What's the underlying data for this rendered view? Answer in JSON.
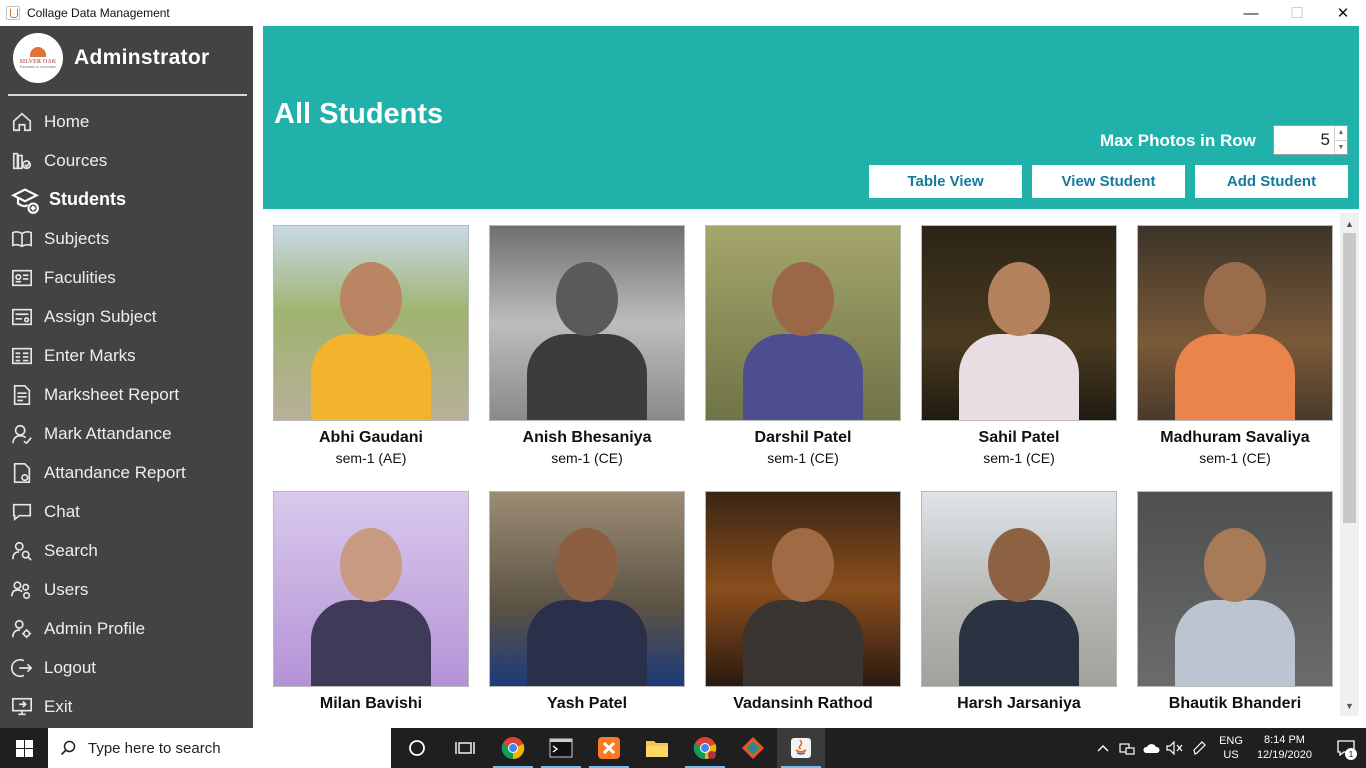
{
  "window": {
    "title": "Collage Data Management",
    "controls": {
      "minimize": "—",
      "maximize": "☐",
      "close": "✕"
    }
  },
  "sidebar": {
    "logo_text": "SILVER OAK",
    "logo_subtext": "Education to Innovation",
    "admin_label": "Adminstrator",
    "items": [
      {
        "label": "Home",
        "icon": "home-icon"
      },
      {
        "label": "Cources",
        "icon": "books-icon"
      },
      {
        "label": "Students",
        "icon": "graduation-cap-icon",
        "active": true
      },
      {
        "label": "Subjects",
        "icon": "open-book-icon"
      },
      {
        "label": "Faculities",
        "icon": "id-card-icon"
      },
      {
        "label": "Assign Subject",
        "icon": "assign-icon"
      },
      {
        "label": "Enter Marks",
        "icon": "marks-icon"
      },
      {
        "label": "Marksheet Report",
        "icon": "report-icon"
      },
      {
        "label": "Mark Attandance",
        "icon": "attendance-icon"
      },
      {
        "label": "Attandance Report",
        "icon": "document-icon"
      },
      {
        "label": "Chat",
        "icon": "chat-icon"
      },
      {
        "label": "Search",
        "icon": "search-user-icon"
      },
      {
        "label": "Users",
        "icon": "users-icon"
      },
      {
        "label": "Admin Profile",
        "icon": "admin-profile-icon"
      },
      {
        "label": "Logout",
        "icon": "logout-icon"
      },
      {
        "label": "Exit",
        "icon": "exit-icon"
      }
    ]
  },
  "header": {
    "title": "All Students",
    "max_photos_label": "Max Photos in Row",
    "max_photos_value": "5",
    "buttons": {
      "table_view": "Table View",
      "view_student": "View Student",
      "add_student": "Add Student"
    },
    "color": "#21b1ab"
  },
  "students": [
    {
      "name": "Abhi Gaudani",
      "sem": "sem-1  (AE)"
    },
    {
      "name": "Anish Bhesaniya",
      "sem": "sem-1  (CE)"
    },
    {
      "name": "Darshil Patel",
      "sem": "sem-1  (CE)"
    },
    {
      "name": "Sahil Patel",
      "sem": "sem-1  (CE)"
    },
    {
      "name": "Madhuram Savaliya",
      "sem": "sem-1  (CE)"
    },
    {
      "name": "Milan Bavishi",
      "sem": ""
    },
    {
      "name": "Yash Patel",
      "sem": ""
    },
    {
      "name": "Vadansinh Rathod",
      "sem": ""
    },
    {
      "name": "Harsh Jarsaniya",
      "sem": ""
    },
    {
      "name": "Bhautik Bhanderi",
      "sem": ""
    }
  ],
  "taskbar": {
    "search_placeholder": "Type here to search",
    "language": "ENG",
    "region": "US",
    "time": "8:14 PM",
    "date": "12/19/2020",
    "notification_count": "1"
  }
}
